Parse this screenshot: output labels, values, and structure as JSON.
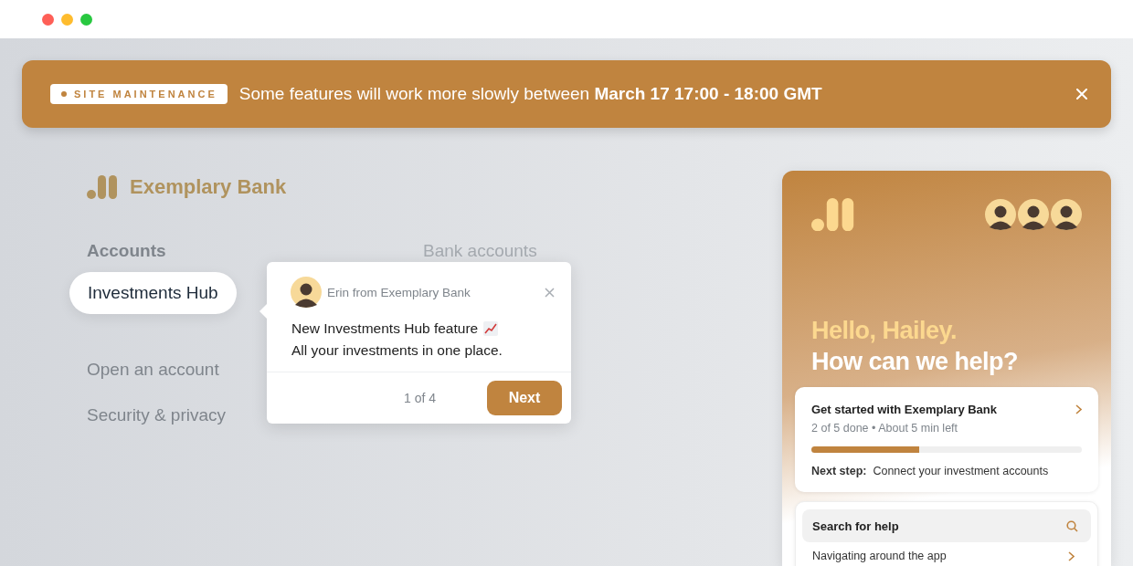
{
  "banner": {
    "tag": "SITE MAINTENANCE",
    "message": "Some features will work more slowly between **March 17 17:00 - 18:00 GMT**"
  },
  "brand": {
    "name": "Exemplary Bank"
  },
  "nav": {
    "heading": "Accounts",
    "items": [
      {
        "label": "Investments Hub",
        "selected": true
      },
      {
        "label": "Open an account",
        "selected": false
      },
      {
        "label": "Security & privacy",
        "selected": false
      }
    ]
  },
  "column_2": {
    "heading": "Bank accounts"
  },
  "tour_popover": {
    "sender": "Erin from Exemplary Bank",
    "title": "New Investments Hub feature",
    "body": "All your investments in one place.",
    "step": "1 of 4",
    "next_button": "Next"
  },
  "help_widget": {
    "greeting": "Hello, Hailey.",
    "question": "How can we help?",
    "onboarding": {
      "title": "Get started with Exemplary Bank",
      "progress_text": "2 of 5 done • About 5 min left",
      "level": 0.4,
      "next_step_label": "Next step:",
      "next_step": "Connect your investment accounts"
    },
    "search": {
      "placeholder": "Search for help"
    },
    "links": [
      "Navigating around the app"
    ]
  }
}
